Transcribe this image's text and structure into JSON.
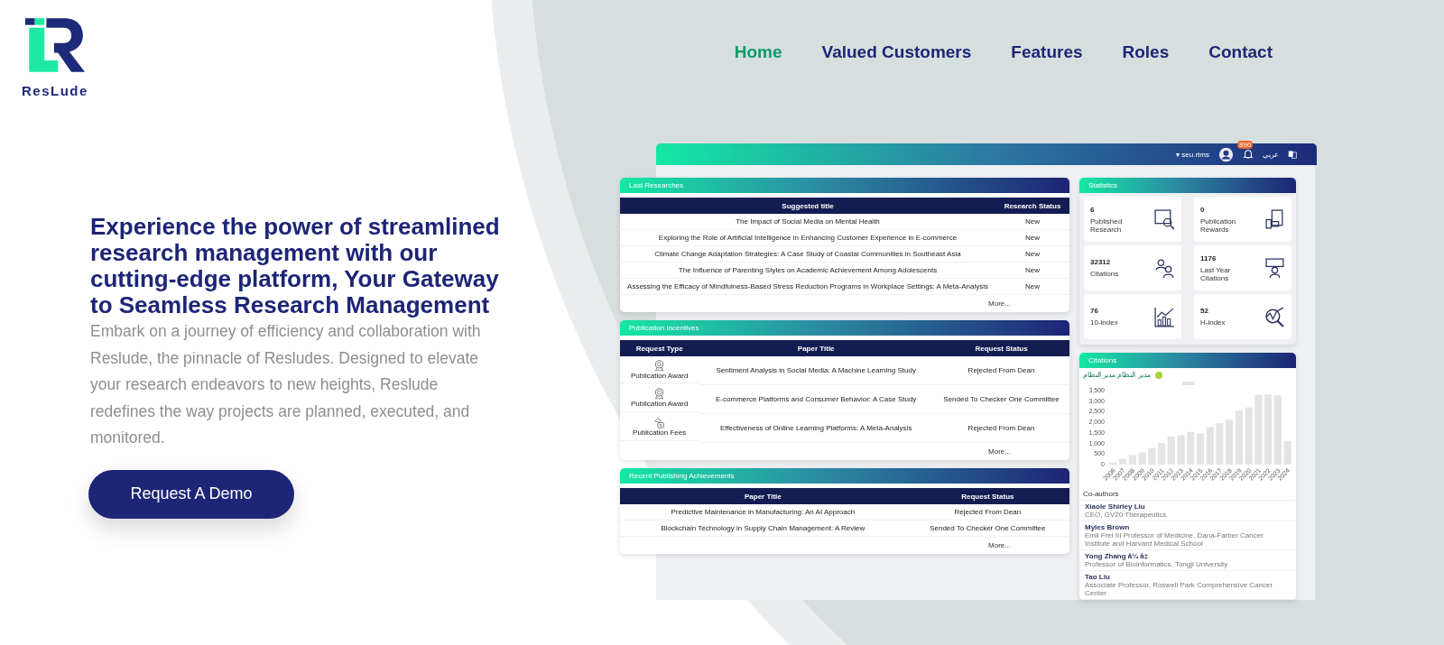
{
  "brand": {
    "name": "ResLude"
  },
  "nav": [
    {
      "label": "Home",
      "selected": true
    },
    {
      "label": "Valued Customers",
      "selected": false
    },
    {
      "label": "Features",
      "selected": false
    },
    {
      "label": "Roles",
      "selected": false
    },
    {
      "label": "Contact",
      "selected": false
    }
  ],
  "hero": {
    "heading": "Experience the power of streamlined research management with our cutting-edge platform, Your Gateway to Seamless Research Management",
    "text": "Embark on a journey of efficiency and collaboration with Reslude, the pinnacle of Resludes. Designed to elevate your research endeavors to new heights, Reslude redefines the way projects are planned, executed, and monitored.",
    "button": "Request A Demo"
  },
  "dashboard": {
    "topbar": {
      "user": "▾ seu.rtms",
      "badge": "890",
      "language": "عربي"
    },
    "last_researches": {
      "title": "Last Researches",
      "columns": [
        "Suggested title",
        "Research Status"
      ],
      "rows": [
        [
          "The Impact of Social Media on Mental Health",
          "New"
        ],
        [
          "Exploring the Role of Artificial Intelligence in Enhancing Customer Experience in E-commerce",
          "New"
        ],
        [
          "Climate Change Adaptation Strategies: A Case Study of Coastal Communities in Southeast Asia",
          "New"
        ],
        [
          "The Influence of Parenting Styles on Academic Achievement Among Adolescents",
          "New"
        ],
        [
          "Assessing the Efficacy of Mindfulness-Based Stress Reduction Programs in Workplace Settings: A Meta-Analysis",
          "New"
        ]
      ],
      "more": "More..."
    },
    "publication_incentives": {
      "title": "Publication Incentives",
      "columns": [
        "Request Type",
        "Paper Title",
        "Request Status"
      ],
      "rows": [
        {
          "kind": "award",
          "type": "Publication Award",
          "title": "Sentiment Analysis in Social Media: A Machine Learning Study",
          "status": "Rejected From Dean"
        },
        {
          "kind": "award",
          "type": "Publication Award",
          "title": "E-commerce Platforms and Consumer Behavior: A Case Study",
          "status": "Sended To Checker One Committee"
        },
        {
          "kind": "fees",
          "type": "Publication Fees",
          "title": "Effectiveness of Online Learning Platforms: A Meta-Analysis",
          "status": "Rejected From Dean"
        }
      ],
      "more": "More..."
    },
    "recent_achievements": {
      "title": "Recent Publishing Achievements",
      "columns": [
        "Paper Title",
        "Request Status"
      ],
      "rows": [
        [
          "Predictive Maintenance in Manufacturing: An AI Approach",
          "Rejected From Dean"
        ],
        [
          "Blockchain Technology in Supply Chain Management: A Review",
          "Sended To Checker One Committee"
        ]
      ],
      "more": "More..."
    },
    "statistics": {
      "title": "Statistics",
      "tiles": [
        {
          "kind": "research",
          "value": "6",
          "label": "Published Research"
        },
        {
          "kind": "rewards",
          "value": "0",
          "label": "Publication Rewards"
        },
        {
          "kind": "citations",
          "value": "32312",
          "label": "Citations"
        },
        {
          "kind": "quote",
          "value": "1176",
          "label": "Last Year Citations"
        },
        {
          "kind": "growth",
          "value": "76",
          "label": "10-index"
        },
        {
          "kind": "hindex",
          "value": "52",
          "label": "H-index"
        }
      ]
    },
    "citations": {
      "title": "Citations",
      "profile": "مدير النظام مدير النظام",
      "chart_data": {
        "type": "bar",
        "categories": [
          "2006",
          "2007",
          "2008",
          "2009",
          "2010",
          "2011",
          "2012",
          "2013",
          "2014",
          "2015",
          "2016",
          "2017",
          "2018",
          "2019",
          "2020",
          "2021",
          "2022",
          "2023",
          "2024"
        ],
        "series": [
          {
            "color": "#e4e4e4",
            "values": [
              100,
              280,
              450,
              580,
              780,
              1020,
              1330,
              1400,
              1550,
              1480,
              1780,
              1960,
              2120,
              2550,
              2700,
              3300,
              3320,
              3280,
              1120
            ]
          }
        ],
        "ylim": [
          0,
          3500
        ],
        "yticks": [
          {
            "value": 0,
            "label": "0"
          },
          {
            "value": 500,
            "label": "500"
          },
          {
            "value": 1000,
            "label": "1,000"
          },
          {
            "value": 1500,
            "label": "1,500"
          },
          {
            "value": 2000,
            "label": "2,000"
          },
          {
            "value": 2500,
            "label": "2,500"
          },
          {
            "value": 3000,
            "label": "3,000"
          },
          {
            "value": 3500,
            "label": "3,500"
          }
        ]
      },
      "coauthors_title": "Co-authors",
      "coauthors": [
        {
          "name": "Xiaole Shirley Liu",
          "role": "CEO, GV20 Therapeutics"
        },
        {
          "name": "Myles Brown",
          "role": "Emil Frei III Professor of Medicine, Dana-Farber Cancer Institute and Harvard Medical School"
        },
        {
          "name": "Yong Zhang å¼ å‡",
          "role": "Professor of Bioinformatics, Tongji University"
        },
        {
          "name": "Tao Liu",
          "role": "Associate Professor, Roswell Park Comprehensive Cancer Center"
        }
      ]
    }
  }
}
